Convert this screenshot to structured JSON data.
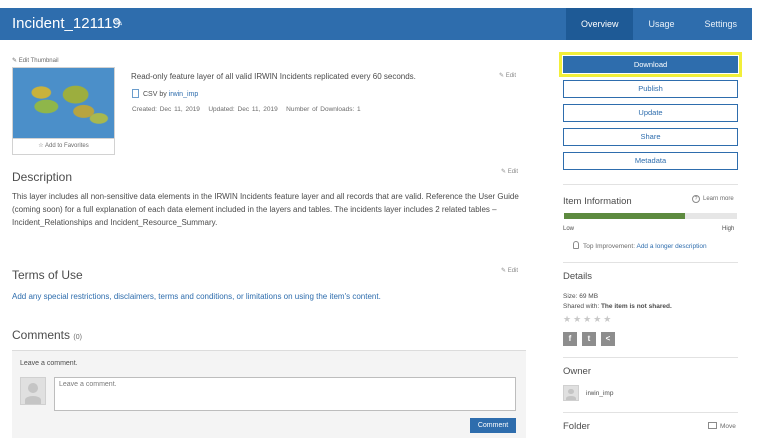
{
  "header": {
    "title": "Incident_121119",
    "tabs": [
      {
        "label": "Overview",
        "active": true
      },
      {
        "label": "Usage",
        "active": false
      },
      {
        "label": "Settings",
        "active": false
      }
    ]
  },
  "thumbnail": {
    "edit_label": "Edit Thumbnail",
    "favorites_label": "Add to Favorites"
  },
  "summary": {
    "text": "Read-only feature layer of all valid IRWIN Incidents replicated every 60 seconds.",
    "edit_label": "Edit",
    "type_label": "CSV by",
    "owner_link": "irwin_imp",
    "created": "Created: Dec 11, 2019",
    "updated": "Updated: Dec 11, 2019",
    "downloads": "Number of Downloads: 1"
  },
  "description": {
    "heading": "Description",
    "edit_label": "Edit",
    "text": "This layer includes all non-sensitive data elements in the IRWIN Incidents feature layer and all records that are valid.  Reference the User Guide (coming soon) for a full explanation of each data element included in the layers and tables.  The incidents layer includes 2 related tables – Incident_Relationships and Incident_Resource_Summary."
  },
  "terms": {
    "heading": "Terms of Use",
    "edit_label": "Edit",
    "link": "Add any special restrictions, disclaimers, terms and conditions, or limitations on using the item's content."
  },
  "comments": {
    "heading": "Comments",
    "count": "(0)",
    "prompt": "Leave a comment.",
    "placeholder": "Leave a comment.",
    "button": "Comment"
  },
  "actions": {
    "download": "Download",
    "publish": "Publish",
    "update": "Update",
    "share": "Share",
    "metadata": "Metadata"
  },
  "item_info": {
    "heading": "Item Information",
    "learn_more": "Learn more",
    "progress": 0.7,
    "low": "Low",
    "high": "High",
    "tip_label": "Top Improvement:",
    "tip_link": "Add a longer description"
  },
  "details": {
    "heading": "Details",
    "size": "Size: 69 MB",
    "shared_label": "Shared with:",
    "shared_value": "The item is not shared.",
    "stars": "★★★★★",
    "social": {
      "facebook": "f",
      "twitter": "t",
      "share": "<"
    }
  },
  "owner": {
    "heading": "Owner",
    "name": "irwin_imp"
  },
  "folder": {
    "heading": "Folder",
    "move": "Move"
  },
  "colors": {
    "accent": "#2e6dad",
    "header": "#2e6dad",
    "active_tab": "#1e5a96",
    "highlight": "#f2ef3a",
    "progress": "#5d8a3f"
  }
}
